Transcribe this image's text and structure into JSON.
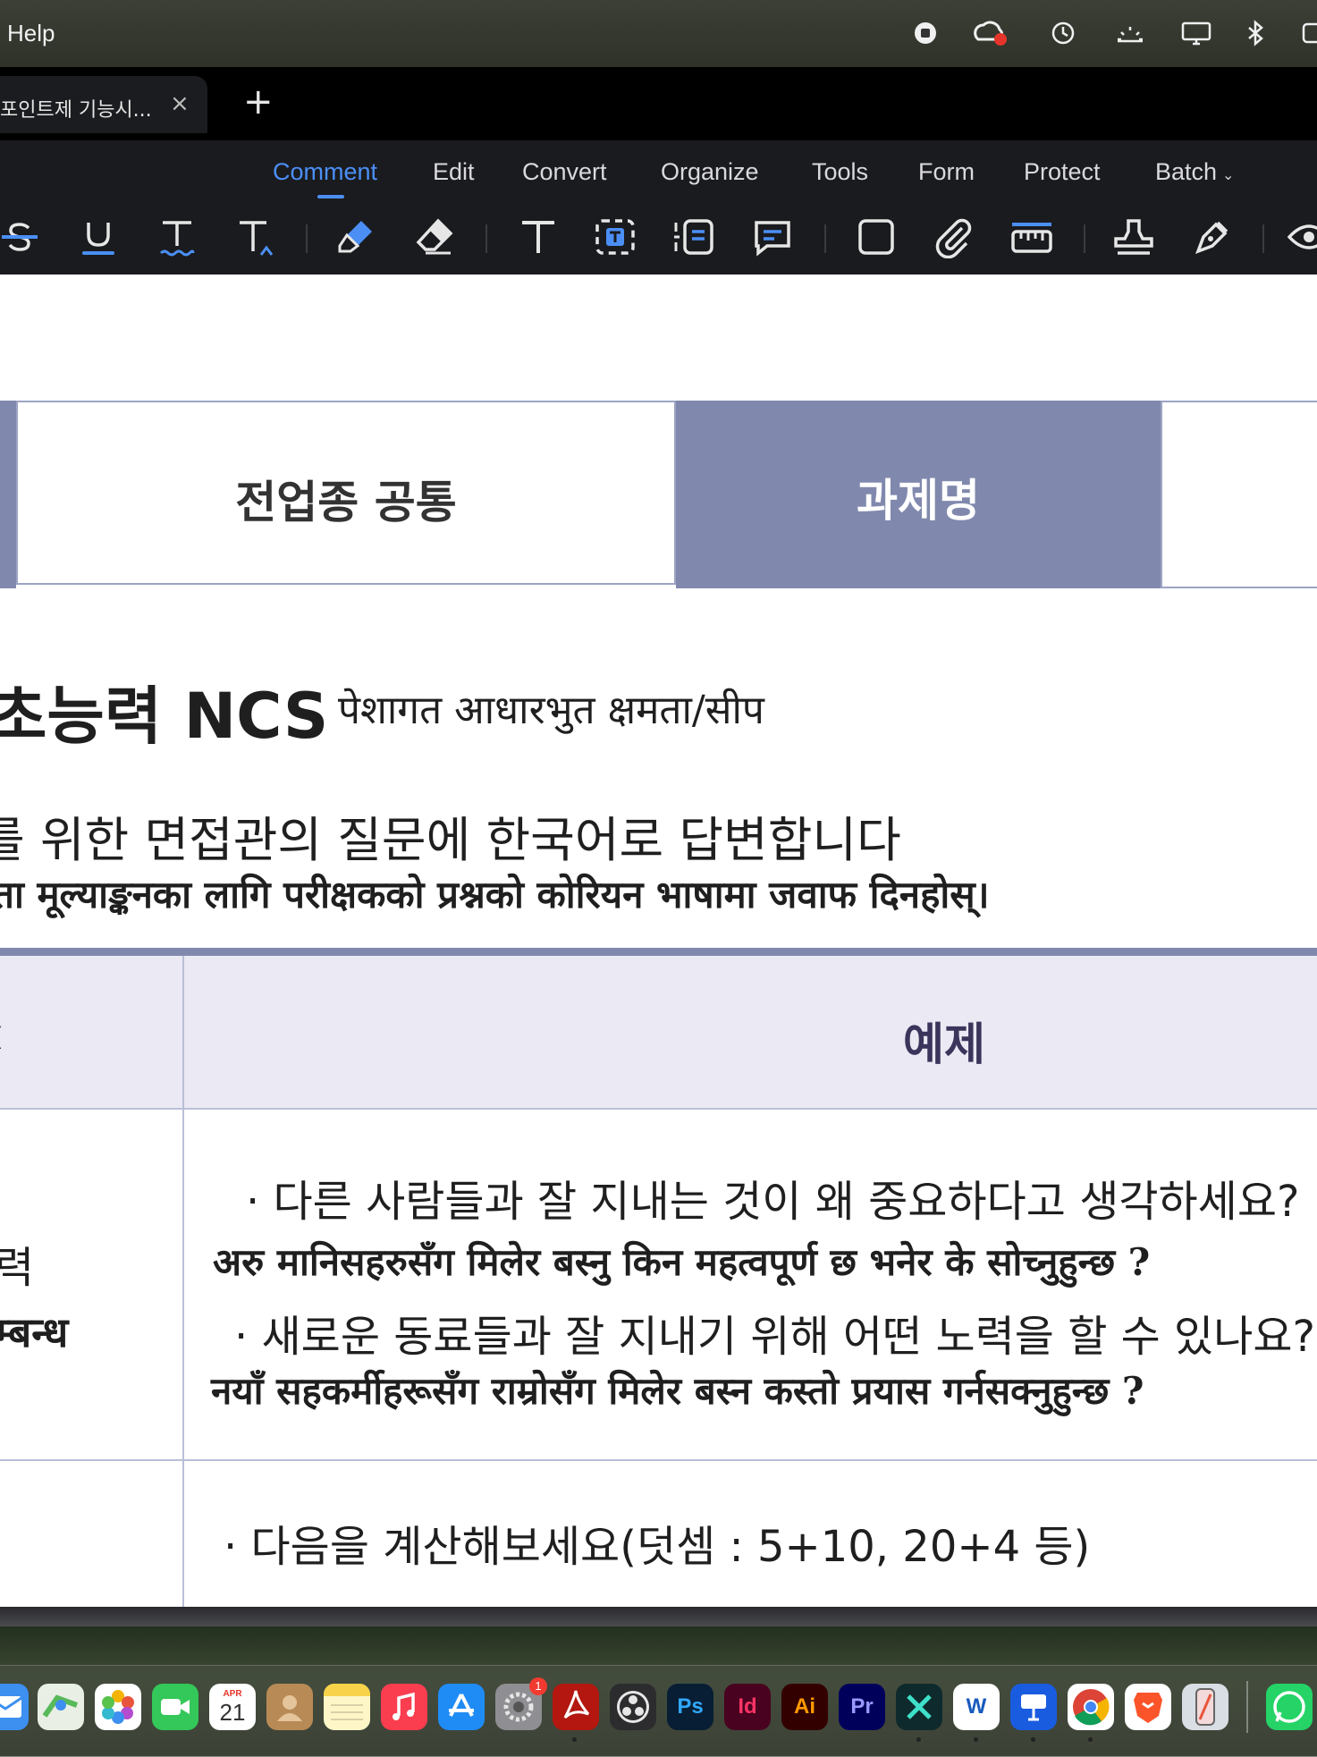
{
  "menubar": {
    "help_label": "Help"
  },
  "tab": {
    "title": "포인트제 기능시...",
    "close_glyph": "×",
    "new_tab_glyph": "+"
  },
  "nav": {
    "items": [
      "Comment",
      "Edit",
      "Convert",
      "Organize",
      "Tools",
      "Form",
      "Protect",
      "Batch"
    ],
    "active": "Comment",
    "accent_color": "#4b8ff5"
  },
  "toolbar": {
    "tools": [
      "strikethrough-icon",
      "underline-icon",
      "squiggly-underline-icon",
      "text-insert-icon",
      "highlighter-icon",
      "eraser-icon",
      "text-icon",
      "text-box-icon",
      "text-callout-icon",
      "note-icon",
      "rectangle-icon",
      "attachment-icon",
      "measure-icon",
      "stamp-icon",
      "signature-icon",
      "eye-icon"
    ]
  },
  "document": {
    "header_left": "전업종 공통",
    "header_mid": "과제명",
    "heading_ko": "초능력  NCS",
    "heading_ne": "पेशागत आधारभुत क्षमता/सीप",
    "task_ko": "를 위한 면접관의 질문에 한국어로 답변합니다",
    "task_ne": "ता मूल्याङ्कनका लागि परीक्षकको प्रश्नको कोरियन भाषामा जवाफ दिनहोस्।",
    "table": {
      "header_left": "ː",
      "header_example": "예제",
      "row1_left_ko": "력",
      "row1_left_ne": "म्बन्ध",
      "row1_q1_ko": "· 다른 사람들과 잘 지내는 것이 왜 중요하다고 생각하세요?",
      "row1_q1_ne": "अरु मानिसहरुसँग मिलेर बस्नु किन महत्वपूर्ण छ भनेर के सोच्नुहुन्छ ?",
      "row1_q2_ko": "· 새로운 동료들과 잘 지내기 위해 어떤 노력을 할 수 있나요?",
      "row1_q2_ne": "नयाँ सहकर्मीहरूसँग राम्रोसँग मिलेर बस्न कस्तो प्रयास गर्नसक्नुहुन्छ ?",
      "row2_q1_ko": "· 다음을 계산해보세요(덧셈 : 5+10, 20+4 등)"
    },
    "header_fill_color": "#8089ad",
    "table_head_color": "#ebe9f3"
  },
  "dock": {
    "calendar_month": "APR",
    "calendar_day": "21",
    "settings_badge": "1",
    "apps": [
      "Mail",
      "Maps",
      "Photos",
      "FaceTime",
      "Calendar",
      "Contacts",
      "Notes",
      "Music",
      "App Store",
      "System Settings",
      "Acrobat",
      "OBS",
      "Ps",
      "Id",
      "Ai",
      "Pr",
      "Filmora",
      "W",
      "Flowchart",
      "Chrome",
      "Brave",
      "iPhone Mirroring",
      "WhatsApp"
    ]
  }
}
